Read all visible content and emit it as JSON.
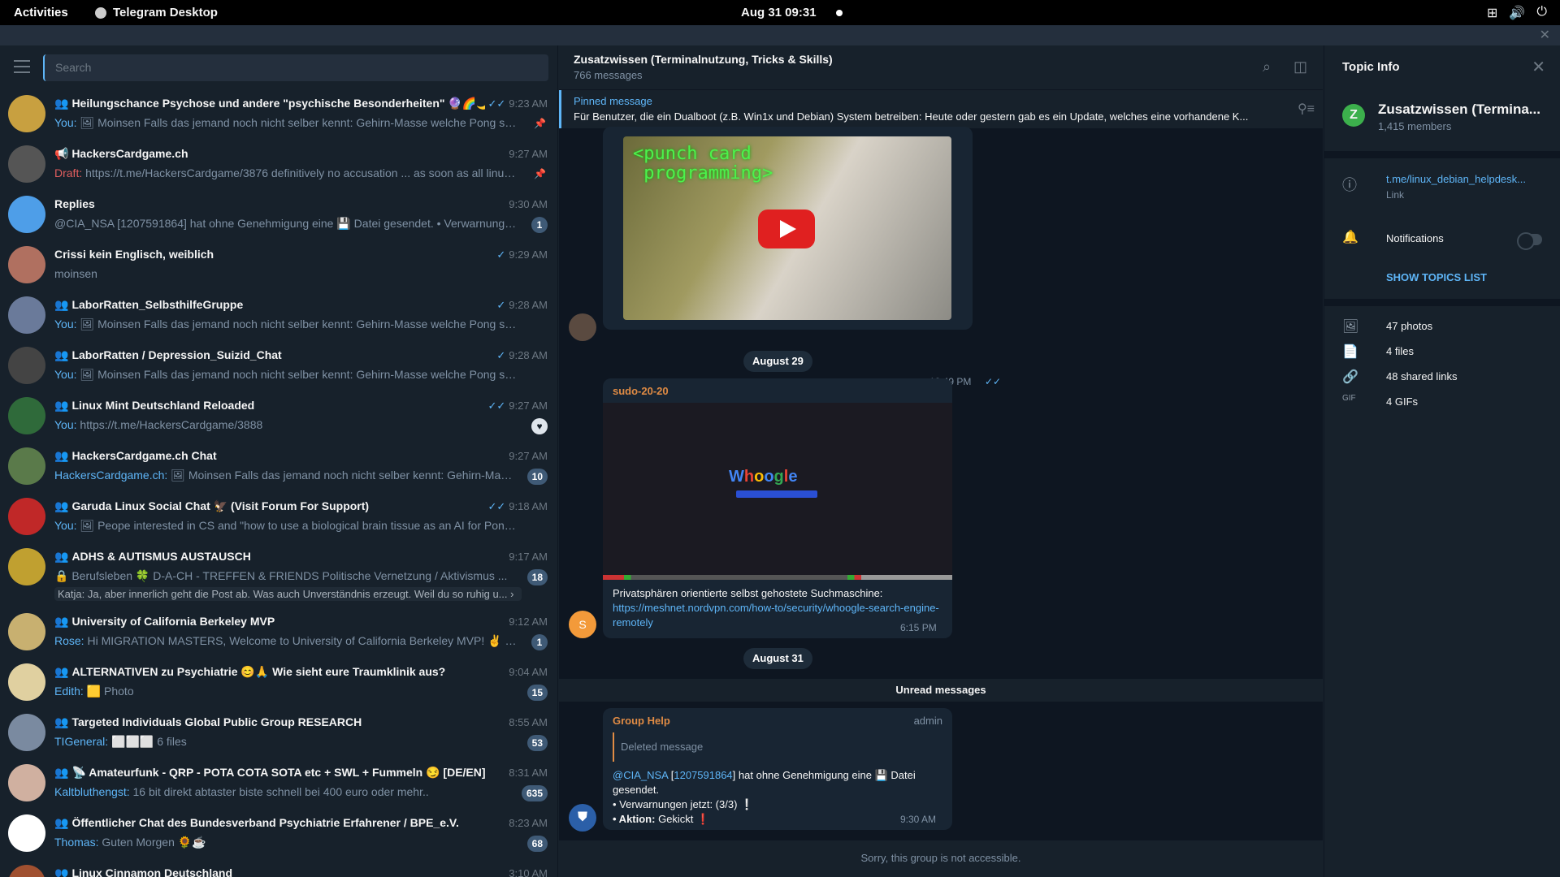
{
  "topbar": {
    "activities": "Activities",
    "app_name": "Telegram Desktop",
    "clock": "Aug 31  09:31"
  },
  "search": {
    "placeholder": "Search"
  },
  "chats": [
    {
      "name": "Heilungschance Psychose und andere \"psychische Besonderheiten\" 🔮🌈🌙",
      "time": "9:23 AM",
      "who": "You:",
      "preview": "🖼 Moinsen  Falls das jemand noch nicht selber kennt:  Gehirn-Masse welche Pong spielt ...",
      "checks": "✓✓",
      "pinned": true,
      "group": true,
      "avatar": "#c8a040"
    },
    {
      "name": "📢 HackersCardgame.ch",
      "time": "9:27 AM",
      "draft": "Draft:",
      "preview": "https://t.me/HackersCardgame/3876  definitively no accusation ... as soon as all linux pe...",
      "pinned": true,
      "avatar": "#555"
    },
    {
      "name": "Replies",
      "time": "9:30 AM",
      "preview": "@CIA_NSA [1207591864] hat ohne Genehmigung eine 💾 Datei gesendet.  • Verwarnungen jet...",
      "badge": "1",
      "avatar": "#4e9ee8"
    },
    {
      "name": "Crissi kein Englisch, weiblich",
      "time": "9:29 AM",
      "checks": "✓",
      "preview": "moinsen",
      "avatar": "#b07060"
    },
    {
      "name": "LaborRatten_SelbsthilfeGruppe",
      "time": "9:28 AM",
      "checks": "✓",
      "who": "You:",
      "preview": "🖼 Moinsen  Falls das jemand noch nicht selber kennt:  Gehirn-Masse welche Pong spielt  htt...",
      "group": true,
      "avatar": "#6a7a9a"
    },
    {
      "name": "LaborRatten / Depression_Suizid_Chat",
      "time": "9:28 AM",
      "checks": "✓",
      "who": "You:",
      "preview": "🖼 Moinsen  Falls das jemand noch nicht selber kennt:  Gehirn-Masse welche Pong spielt  htt...",
      "group": true,
      "avatar": "#444"
    },
    {
      "name": "Linux Mint Deutschland Reloaded",
      "time": "9:27 AM",
      "checks": "✓✓",
      "who": "You:",
      "preview": "https://t.me/HackersCardgame/3888",
      "heart": "♥",
      "group": true,
      "avatar": "#2f6a3a"
    },
    {
      "name": "HackersCardgame.ch Chat",
      "time": "9:27 AM",
      "who": "HackersCardgame.ch:",
      "preview": "🖼 Moinsen  Falls das jemand noch nicht selber kennt:  Gehirn-Masse ...",
      "badge": "10",
      "group": true,
      "avatar": "#5a7a4a"
    },
    {
      "name": "Garuda Linux Social Chat 🦅 (Visit Forum For Support)",
      "time": "9:18 AM",
      "checks": "✓✓",
      "who": "You:",
      "preview": "🖼 Peope interested in CS and \"how to use a biological brain tissue as an AI for Pong\" maybe ...",
      "group": true,
      "avatar": "#c02828"
    },
    {
      "name": "ADHS & AUTISMUS AUSTAUSCH",
      "time": "9:17 AM",
      "preview": "🔒 Berufsleben    🍀 D-A-CH - TREFFEN & FRIENDS   Politische Vernetzung / Aktivismus  ...",
      "preview2": "Katja: Ja, aber innerlich geht die Post ab. Was auch Unverständnis erzeugt. Weil du so ruhig u...  ›",
      "badge": "18",
      "group": true,
      "avatar": "#c0a030"
    },
    {
      "name": "University of California Berkeley MVP",
      "time": "9:12 AM",
      "who": "Rose:",
      "preview": "Hi MIGRATION MASTERS, Welcome to University of California Berkeley MVP! ✌ Make su...",
      "badge": "1",
      "group": true,
      "avatar": "#c8b070"
    },
    {
      "name": "ALTERNATIVEN zu Psychiatrie 😊🙏 Wie sieht eure Traumklinik aus?",
      "time": "9:04 AM",
      "who": "Edith:",
      "preview": "🟨 Photo",
      "badge": "15",
      "group": true,
      "avatar": "#e0d0a0"
    },
    {
      "name": "Targeted Individuals Global Public Group RESEARCH",
      "time": "8:55 AM",
      "who": "TIGeneral:",
      "preview": "⬜⬜⬜ 6 files",
      "badge": "53",
      "group": true,
      "avatar": "#7a8aa0"
    },
    {
      "name": "📡 Amateurfunk - QRP - POTA COTA SOTA etc + SWL + Fummeln 😏 [DE/EN]",
      "time": "8:31 AM",
      "who": "Kaltbluthengst:",
      "preview": "16 bit direkt abtaster biste schnell bei 400 euro oder mehr..",
      "badge": "635",
      "group": true,
      "avatar": "#d0b0a0"
    },
    {
      "name": "Öffentlicher Chat des Bundesverband Psychiatrie Erfahrener / BPE_e.V.",
      "time": "8:23 AM",
      "who": "Thomas:",
      "preview": "Guten Morgen 🌻☕",
      "badge": "68",
      "group": true,
      "avatar": "#fff"
    },
    {
      "name": "Linux Cinnamon Deutschland",
      "time": "3:10 AM",
      "preview": "",
      "group": true,
      "avatar": "#a05030"
    }
  ],
  "conversation": {
    "title": "Zusatzwissen (Terminalnutzung, Tricks & Skills)",
    "subtitle": "766 messages",
    "pinned_label": "Pinned message",
    "pinned_text": "Für Benutzer, die ein Dualboot (z.B. Win1x und Debian) System betreiben: Heute oder gestern gab es ein Update, welches eine vorhandene K...",
    "video_caption": "<punch card\n programming>",
    "video_time": "12:49 PM",
    "date1": "August 29",
    "sender1": "sudo-20-20",
    "whoogle_logo": "Whoogle",
    "msg1_text": "Privatsphären orientierte selbst gehostete Suchmaschine:",
    "msg1_link": "https://meshnet.nordvpn.com/how-to/security/whoogle-search-engine-remotely",
    "msg1_time": "6:15 PM",
    "date2": "August 31",
    "unread": "Unread messages",
    "sender2": "Group Help",
    "sender2_role": "admin",
    "quote": "Deleted message",
    "msg2_mention": "@CIA_NSA",
    "msg2_id": "1207591864",
    "msg2_text": "hat ohne Genehmigung eine 💾 Datei gesendet.",
    "msg2_line2": "• Verwarnungen jetzt: (3/3) ❕",
    "msg2_line3a": "• Aktion:",
    "msg2_line3b": "Gekickt ❗",
    "msg2_time": "9:30 AM",
    "footer": "Sorry, this group is not accessible."
  },
  "info": {
    "title": "Topic Info",
    "avatar_letter": "Z",
    "name": "Zusatzwissen (Termina...",
    "members": "1,415 members",
    "link": "t.me/linux_debian_helpdesk...",
    "link_label": "Link",
    "notifications": "Notifications",
    "show_topics": "SHOW TOPICS LIST",
    "media": [
      {
        "icon": "🖼",
        "label": "47 photos"
      },
      {
        "icon": "📄",
        "label": "4 files"
      },
      {
        "icon": "🔗",
        "label": "48 shared links"
      },
      {
        "icon": "GIF",
        "label": "4 GIFs"
      }
    ]
  }
}
